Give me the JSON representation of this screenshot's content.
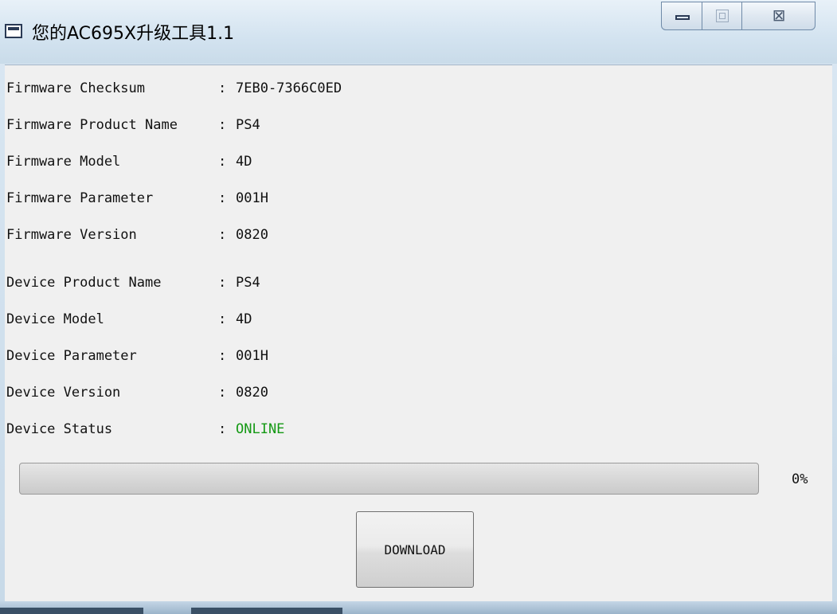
{
  "window": {
    "title": "您的AC695X升级工具1.1",
    "icon": "app-window-icon",
    "controls": {
      "minimize_icon": "minimize-icon",
      "maximize_icon": "maximize-icon",
      "close_glyph": "⊠"
    }
  },
  "info": {
    "separator": ":",
    "rows": [
      {
        "label": "Firmware Checksum",
        "value": "7EB0-7366C0ED"
      },
      {
        "label": "Firmware Product Name",
        "value": "PS4"
      },
      {
        "label": "Firmware Model",
        "value": "4D"
      },
      {
        "label": "Firmware Parameter",
        "value": "001H"
      },
      {
        "label": "Firmware Version",
        "value": "0820"
      },
      {
        "label": "Device Product Name",
        "value": "PS4"
      },
      {
        "label": "Device Model",
        "value": "4D"
      },
      {
        "label": "Device Parameter",
        "value": "001H"
      },
      {
        "label": "Device Version",
        "value": "0820"
      },
      {
        "label": "Device Status",
        "value": "ONLINE"
      }
    ]
  },
  "progress": {
    "value": 0,
    "percent_label": "0%"
  },
  "actions": {
    "download_label": "DOWNLOAD"
  },
  "colors": {
    "status_online": "#149914"
  }
}
